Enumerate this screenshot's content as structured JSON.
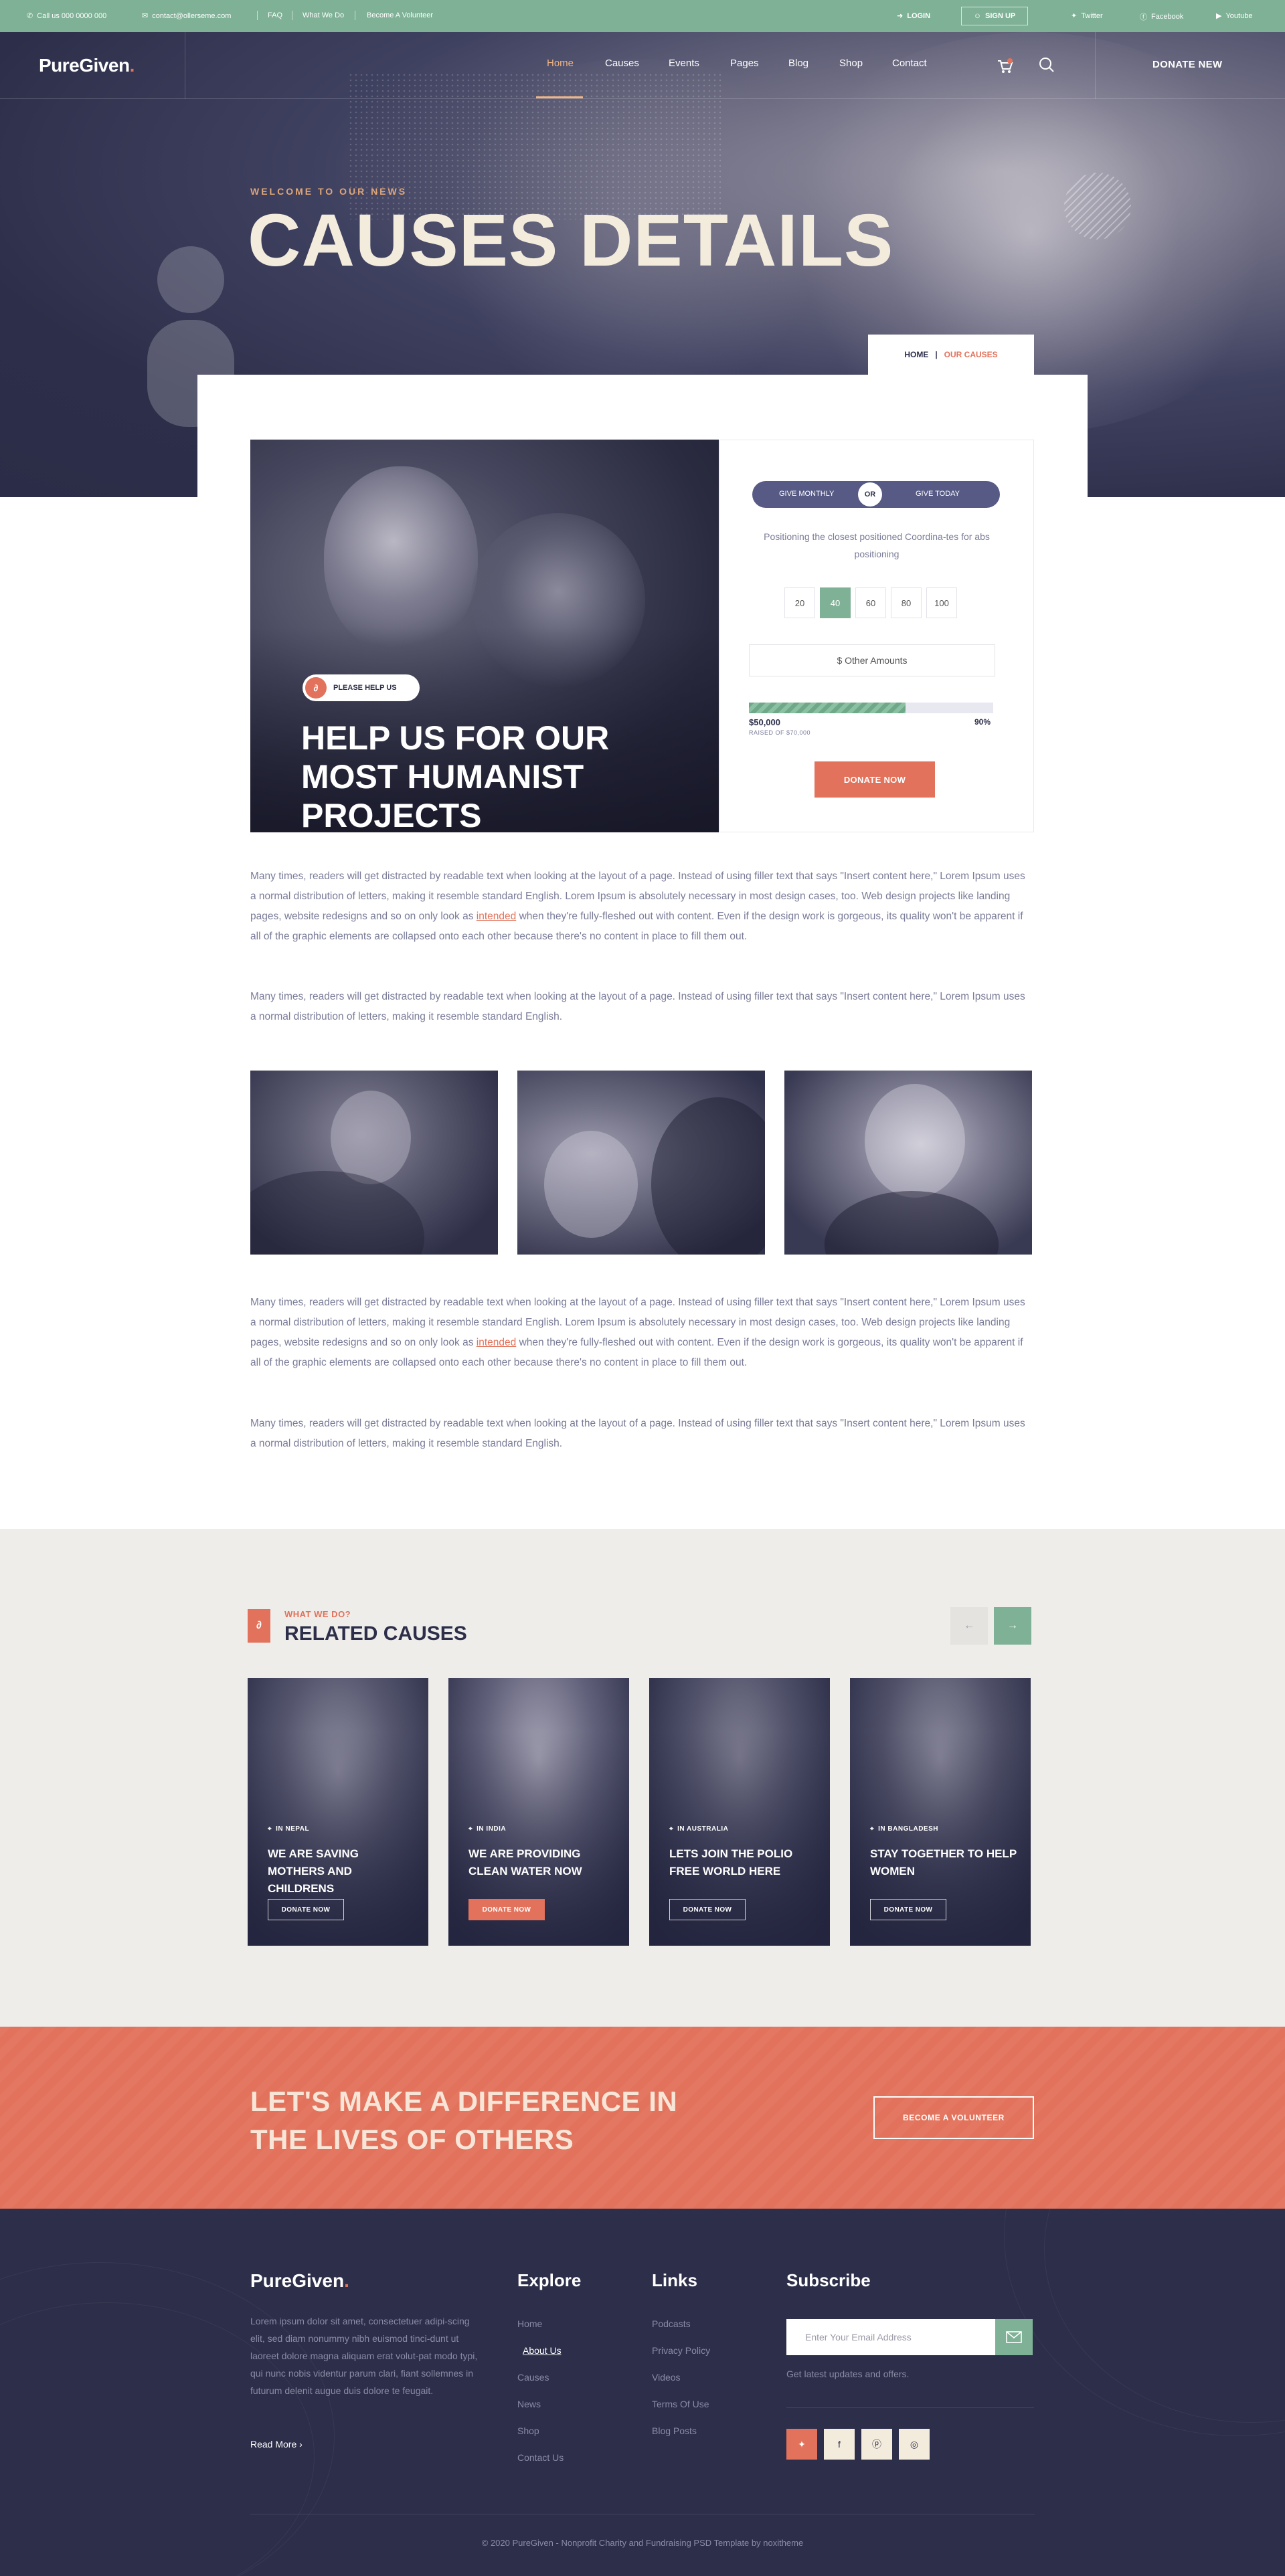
{
  "topbar": {
    "phone": "Call us 000 0000 000",
    "email": "contact@ollerseme.com",
    "faq": "FAQ",
    "what_we_do": "What We Do",
    "volunteer": "Become A Volunteer",
    "login": "LOGIN",
    "signup": "SIGN UP",
    "twitter": "Twitter",
    "facebook": "Facebook",
    "youtube": "Youtube"
  },
  "header": {
    "logo": "PureGiven",
    "nav": [
      "Home",
      "Causes",
      "Events",
      "Pages",
      "Blog",
      "Shop",
      "Contact"
    ],
    "active_nav": "Home",
    "donate_cta": "DONATE NEW"
  },
  "hero": {
    "subtitle": "WELCOME TO OUR NEWS",
    "title": "CAUSES DETAILS",
    "breadcrumb_home": "HOME",
    "breadcrumb_sep": "|",
    "breadcrumb_current": "OUR CAUSES"
  },
  "feature": {
    "badge": "PLEASE HELP US",
    "title": "HELP US FOR OUR MOST HUMANIST PROJECTS"
  },
  "donation": {
    "give_monthly": "GIVE MONTHLY",
    "or": "OR",
    "give_today": "GIVE TODAY",
    "description": "Positioning the closest positioned Coordina-tes for abs positioning",
    "amounts": [
      "20",
      "40",
      "60",
      "80",
      "100"
    ],
    "selected_amount": "40",
    "other_amounts": "$ Other Amounts",
    "raised": "$50,000",
    "goal": "RAISED OF $70,000",
    "percent_label": "90%",
    "progress_fraction": 0.64,
    "donate_button": "DONATE NOW"
  },
  "body": {
    "p1_a": "Many times, readers will get distracted by readable text when looking at the layout of a page. Instead of using filler text that says \"Insert content here,\" Lorem Ipsum uses a normal distribution of letters, making it resemble standard English. Lorem Ipsum is absolutely necessary in most design cases, too. Web design projects like landing pages, website redesigns and so on only look as ",
    "p1_link": "intended",
    "p1_b": " when they're fully-fleshed out with content. Even if the design work is gorgeous, its quality won't be apparent if all of the graphic elements are collapsed onto each other because there's no content in place to fill them out.",
    "p2": "Many times, readers will get distracted by readable text when looking at the layout of a page. Instead of using filler text that says \"Insert content here,\" Lorem Ipsum uses a normal distribution of letters, making it resemble standard English.",
    "p3_a": "Many times, readers will get distracted by readable text when looking at the layout of a page. Instead of using filler text that says \"Insert content here,\" Lorem Ipsum uses a normal distribution of letters, making it resemble standard English. Lorem Ipsum is absolutely necessary in most design cases, too. Web design projects like landing pages, website redesigns and so on only look as ",
    "p3_link": "intended",
    "p3_b": " when they're fully-fleshed out with content. Even if the design work is gorgeous, its quality won't be apparent if all of the graphic elements are collapsed onto each other because there's no content in place to fill them out.",
    "p4": "Many times, readers will get distracted by readable text when looking at the layout of a page. Instead of using filler text that says \"Insert content here,\" Lorem Ipsum uses a normal distribution of letters, making it resemble standard English."
  },
  "related": {
    "subtitle": "WHAT WE DO?",
    "title": "RELATED CAUSES",
    "cards": [
      {
        "location": "IN NEPAL",
        "title": "WE ARE SAVING MOTHERS AND CHILDRENS",
        "button": "DONATE NOW"
      },
      {
        "location": "IN INDIA",
        "title": "WE ARE PROVIDING CLEAN WATER NOW",
        "button": "DONATE NOW"
      },
      {
        "location": "IN AUSTRALIA",
        "title": "LETS JOIN THE POLIO FREE WORLD HERE",
        "button": "DONATE NOW"
      },
      {
        "location": "IN BANGLADESH",
        "title": "STAY TOGETHER TO HELP WOMEN",
        "button": "DONATE NOW"
      }
    ]
  },
  "cta": {
    "title": "LET'S MAKE A DIFFERENCE IN THE LIVES OF OTHERS",
    "button": "BECOME A VOLUNTEER"
  },
  "footer": {
    "logo": "PureGiven",
    "about": "Lorem ipsum dolor sit amet, consectetuer adipi-scing elit, sed diam nonummy nibh euismod tinci-dunt ut laoreet dolore magna aliquam erat volut-pat modo typi, qui nunc nobis videntur parum clari, fiant sollemnes in futurum delenit augue duis dolore te feugait.",
    "read_more": "Read More",
    "explore_title": "Explore",
    "explore": [
      "Home",
      "About Us",
      "Causes",
      "News",
      "Shop",
      "Contact Us"
    ],
    "links_title": "Links",
    "links": [
      "Podcasts",
      "Privacy Policy",
      "Videos",
      "Terms Of Use",
      "Blog Posts"
    ],
    "subscribe_title": "Subscribe",
    "subscribe_placeholder": "Enter Your Email Address",
    "subscribe_note": "Get latest updates and offers.",
    "copyright": "© 2020 PureGiven - Nonprofit Charity and Fundraising PSD Template by noxitheme"
  },
  "colors": {
    "green": "#7fb196",
    "coral": "#e2725b",
    "navy": "#2d2f4a",
    "gold": "#f0b584"
  }
}
